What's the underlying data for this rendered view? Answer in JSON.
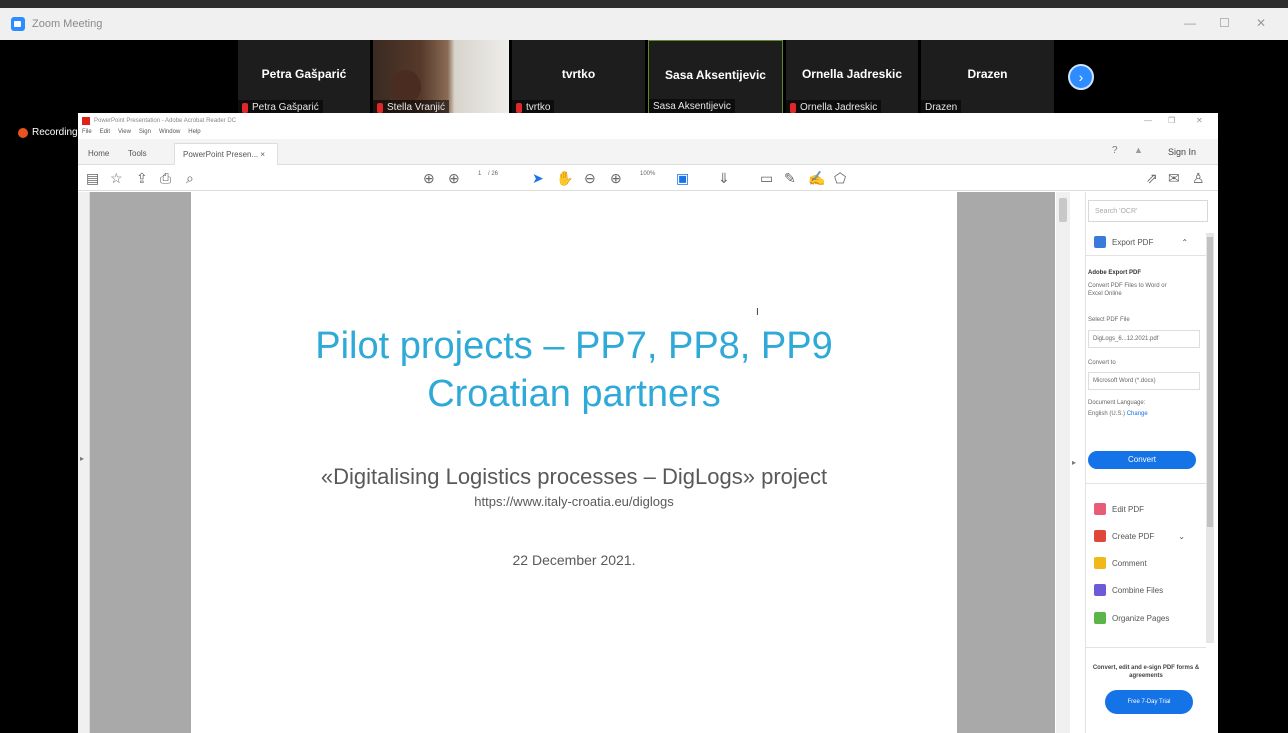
{
  "zoom": {
    "window_title": "Zoom Meeting",
    "minimize": "—",
    "maximize": "☐",
    "close": "✕",
    "recording_label": "Recording"
  },
  "participants": [
    {
      "display": "Petra Gašparić",
      "label": "Petra Gašparić",
      "muted": true
    },
    {
      "display": "",
      "label": "Stella Vranjić",
      "muted": true,
      "video": true
    },
    {
      "display": "tvrtko",
      "label": "tvrtko",
      "muted": true
    },
    {
      "display": "Sasa Aksentijevic",
      "label": "Sasa Aksentijevic",
      "muted": false,
      "active": true
    },
    {
      "display": "Ornella Jadreskic",
      "label": "Ornella Jadreskic",
      "muted": true
    },
    {
      "display": "Drazen",
      "label": "Drazen",
      "muted": false
    }
  ],
  "acrobat": {
    "window_title": "PowerPoint Presentation - Adobe Acrobat Reader DC",
    "menu": [
      "File",
      "Edit",
      "View",
      "Sign",
      "Window",
      "Help"
    ],
    "tabs": [
      "Home",
      "Tools",
      "PowerPoint Presen... ×"
    ],
    "help_icon": "?",
    "bell_icon": "🔔",
    "sign_in": "Sign In",
    "page_current": "1",
    "page_total": "/ 26",
    "zoom_level": "100%",
    "slide": {
      "title_line1": "Pilot projects – PP7, PP8, PP9",
      "title_line2": "Croatian partners",
      "subtitle": "«Digitalising Logistics processes – DigLogs» project",
      "url": "https://www.italy-croatia.eu/diglogs",
      "date": "22 December 2021."
    },
    "right_pane": {
      "search_placeholder": "Search 'OCR'",
      "export_pdf": "Export PDF",
      "adobe_export_pdf": "Adobe Export PDF",
      "export_desc": "Convert PDF Files to Word or Excel Online",
      "select_file_label": "Select PDF File",
      "selected_file": "DigLogs_6...12.2021.pdf",
      "convert_to_label": "Convert to",
      "convert_to_value": "Microsoft Word (*.docx)",
      "doc_language_label": "Document Language:",
      "doc_language_value": "English (U.S.)",
      "change_link": "Change",
      "convert_button": "Convert",
      "tools": [
        "Edit PDF",
        "Create PDF",
        "Comment",
        "Combine Files",
        "Organize Pages"
      ],
      "promo_text": "Convert, edit and e-sign PDF forms & agreements",
      "trial_button": "Free 7-Day Trial"
    }
  }
}
